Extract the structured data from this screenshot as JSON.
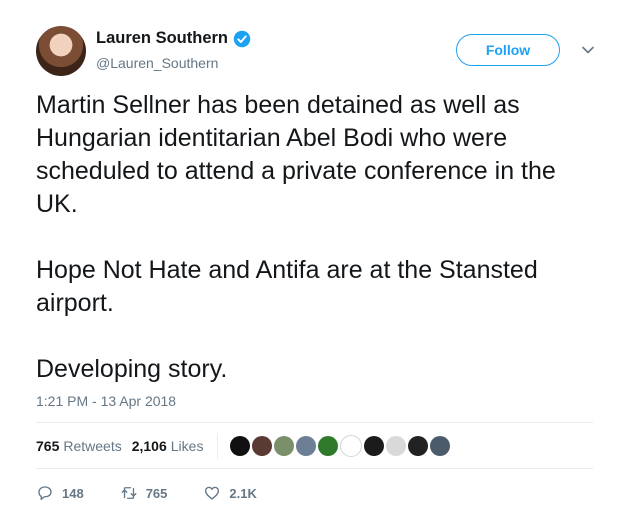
{
  "user": {
    "display_name": "Lauren Southern",
    "handle": "@Lauren_Southern",
    "verified": true
  },
  "follow_button": {
    "label": "Follow"
  },
  "tweet": {
    "text": "Martin Sellner has been detained as well as Hungarian identitarian Abel Bodi who were scheduled to attend a private conference in the UK.\n\nHope Not Hate and Antifa are at the Stansted airport.\n\nDeveloping story.",
    "timestamp": "1:21 PM - 13 Apr 2018"
  },
  "stats": {
    "retweets_count": "765",
    "retweets_label": "Retweets",
    "likes_count": "2,106",
    "likes_label": "Likes"
  },
  "actions": {
    "reply_count": "148",
    "retweet_count": "765",
    "like_count": "2.1K"
  },
  "likers": [
    {
      "color": "#111111"
    },
    {
      "color": "#5a3a32"
    },
    {
      "color": "#7b8f6a"
    },
    {
      "color": "#6d7f95"
    },
    {
      "color": "#2f7a2a"
    },
    {
      "color": "#ffffff"
    },
    {
      "color": "#1b1b1b"
    },
    {
      "color": "#d9d9d9"
    },
    {
      "color": "#222222"
    },
    {
      "color": "#4b5b6b"
    }
  ],
  "colors": {
    "accent": "#1da1f2",
    "muted": "#657786",
    "text": "#14171a"
  }
}
